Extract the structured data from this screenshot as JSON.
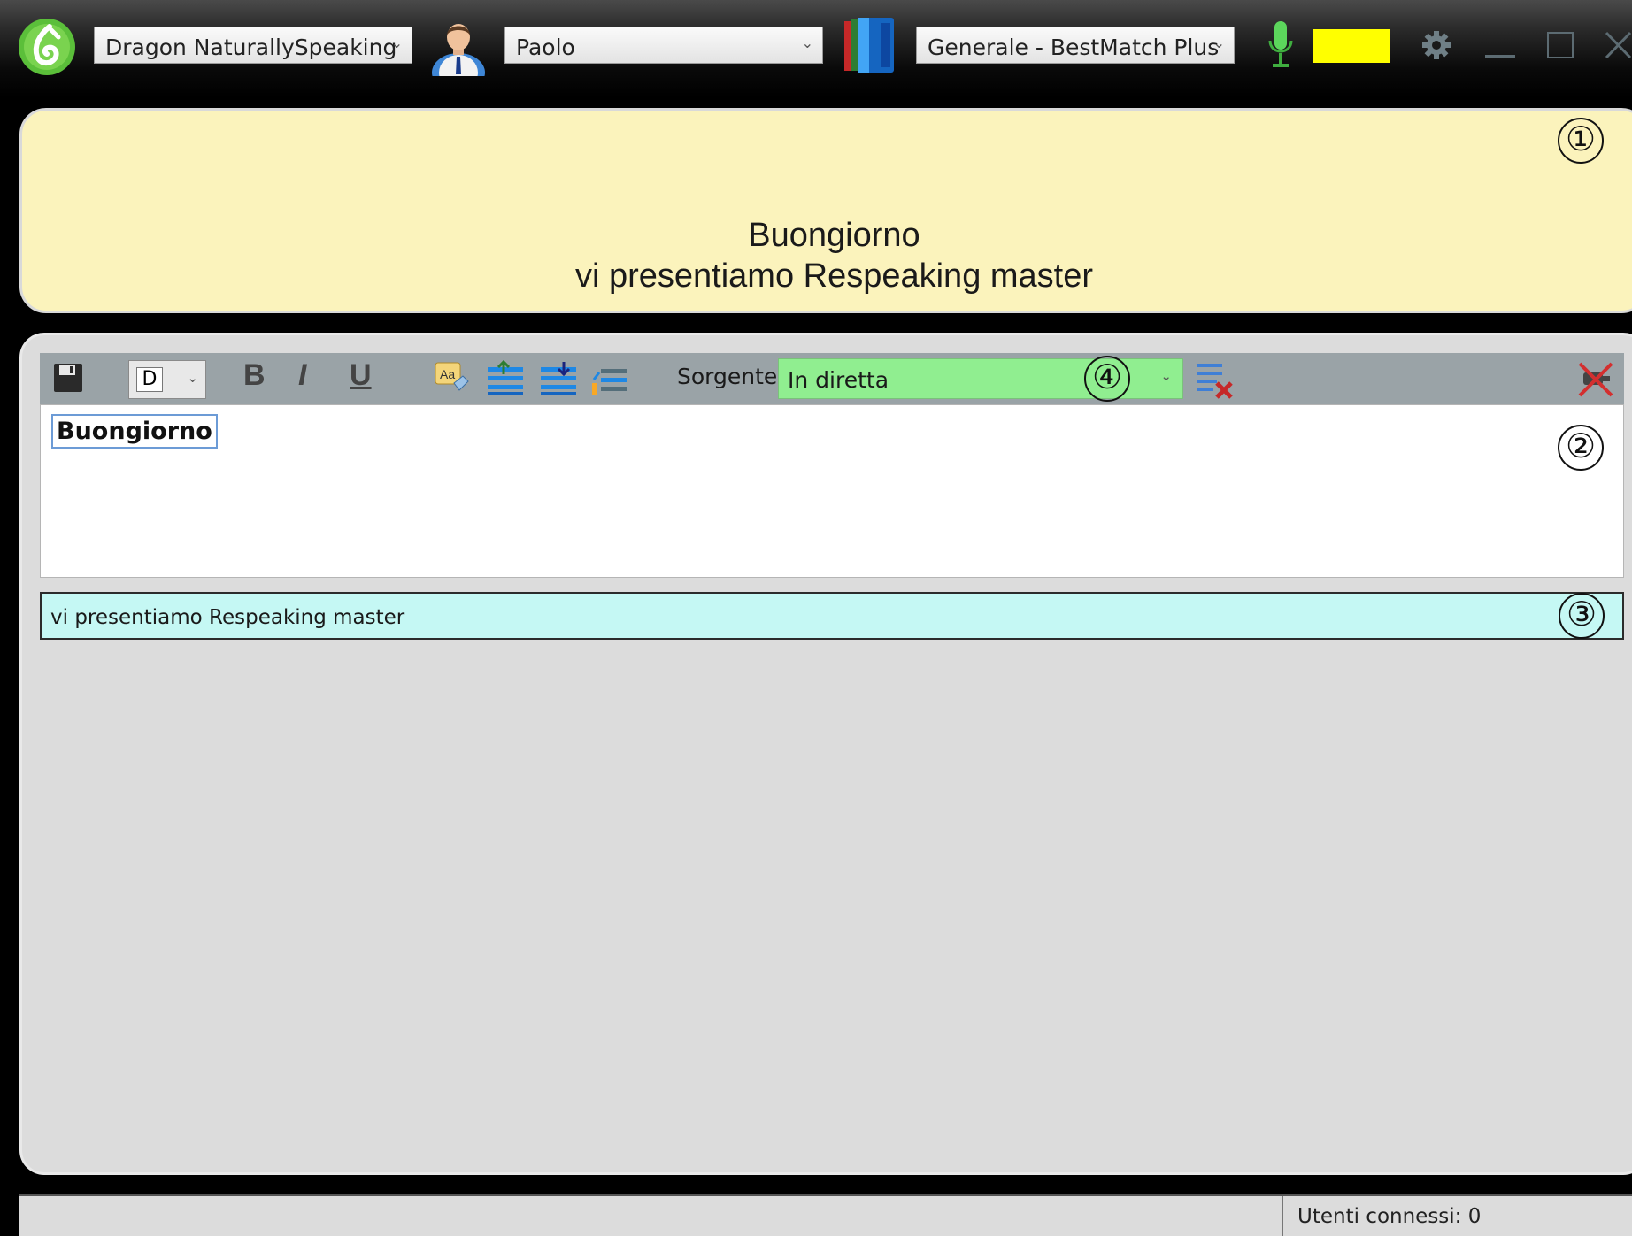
{
  "topbar": {
    "engine_select": "Dragon NaturallySpeaking",
    "user_select": "Paolo",
    "vocabulary_select": "Generale - BestMatch Plus",
    "level_color": "#ffff00",
    "icons": [
      "dragon-logo-icon",
      "user-avatar-icon",
      "vocabulary-book-icon",
      "microphone-icon",
      "settings-gear-icon",
      "minimize-icon",
      "maximize-icon",
      "close-icon"
    ]
  },
  "caption": {
    "line1": "Buongiorno",
    "line2": "vi presentiamo Respeaking master"
  },
  "markers": {
    "m1": "①",
    "m2": "②",
    "m3": "③",
    "m4": "④"
  },
  "editor": {
    "style_value": "D",
    "bold": "B",
    "italic": "I",
    "underline": "U",
    "source_label": "Sorgente:",
    "source_value": "In diretta",
    "current_word": "Buongiorno",
    "pending_text": "vi presentiamo Respeaking master"
  },
  "status": {
    "users_connected": "Utenti connessi: 0"
  },
  "colors": {
    "caption_bg": "#fbf3bc",
    "source_bg": "#90ee90",
    "pending_bg": "#c5f8f4",
    "panel_bg": "#dcdcdc"
  }
}
